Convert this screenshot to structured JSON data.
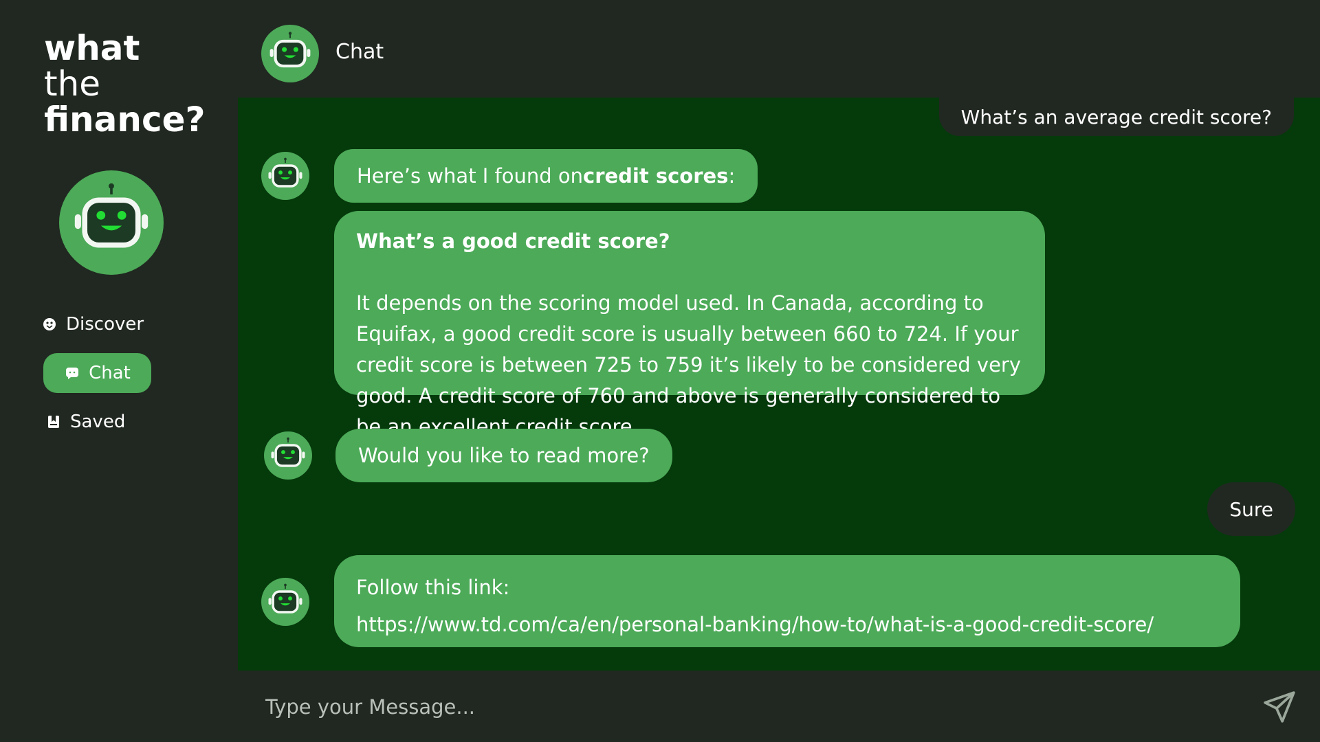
{
  "app": {
    "logo_line1": "what",
    "logo_line2": "the",
    "logo_line3": "finance?"
  },
  "sidebar": {
    "items": [
      {
        "label": "Discover",
        "icon": "discover-icon",
        "active": false
      },
      {
        "label": "Chat",
        "icon": "chat-icon",
        "active": true
      },
      {
        "label": "Saved",
        "icon": "bookmark-icon",
        "active": false
      }
    ]
  },
  "header": {
    "title": "Chat",
    "avatar_icon": "robot-icon"
  },
  "messages": [
    {
      "from": "user",
      "text": "What’s an average credit score?"
    },
    {
      "from": "bot",
      "text_prefix": "Here’s what I found on ",
      "text_bold": "credit scores",
      "text_suffix": ":"
    },
    {
      "from": "bot",
      "heading": "What’s a good credit score?",
      "text": "It depends on the scoring model used. In Canada, according to Equifax, a good credit score is usually between 660 to 724. If your credit score is between 725 to 759 it’s likely to be considered very good. A credit score of 760 and above is generally considered to be an excellent credit score."
    },
    {
      "from": "bot",
      "text": "Would you like to read more?"
    },
    {
      "from": "user",
      "text": "Sure"
    },
    {
      "from": "bot",
      "text": "Follow this link:",
      "link": "https://www.td.com/ca/en/personal-banking/how-to/what-is-a-good-credit-score/"
    }
  ],
  "composer": {
    "placeholder": "Type your Message...",
    "value": "",
    "send_icon": "send-icon"
  },
  "colors": {
    "background": "#212821",
    "chat_background": "#053a0b",
    "accent": "#4caa58",
    "robot_face": "#1c3a24",
    "robot_eyes": "#22dd33"
  }
}
